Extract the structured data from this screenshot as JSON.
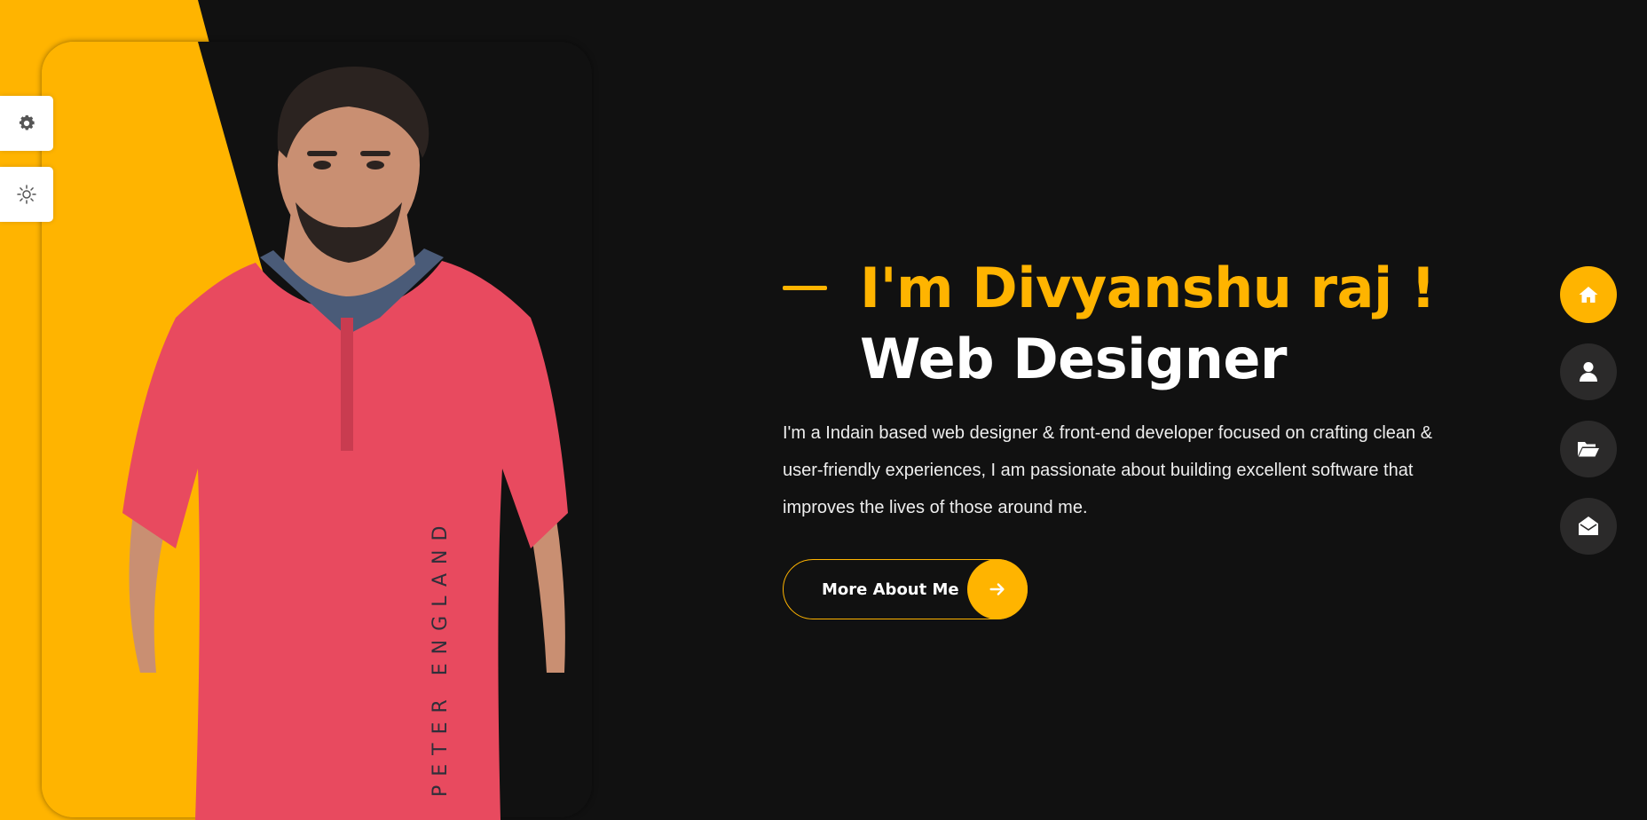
{
  "colors": {
    "accent": "#ffb400",
    "background": "#111111",
    "nav_inactive": "#2b2a2a",
    "shirt": "#e84a5f"
  },
  "settings_panel": {
    "buttons": [
      {
        "icon": "gear-icon"
      },
      {
        "icon": "sun-icon"
      }
    ]
  },
  "portrait": {
    "icon": "person-portrait",
    "shirt_text": "PETER ENGLAND"
  },
  "hero": {
    "name_line": "I'm Divyanshu raj !",
    "role_line": "Web Designer",
    "bio": "I'm a Indain based web designer & front-end developer focused on crafting clean & user-friendly experiences, I am passionate about building excellent software that improves the lives of those around me.",
    "cta_label": "More About Me",
    "cta_icon": "arrow-right-icon"
  },
  "side_nav": {
    "items": [
      {
        "icon": "home-icon",
        "active": true
      },
      {
        "icon": "user-icon",
        "active": false
      },
      {
        "icon": "folder-open-icon",
        "active": false
      },
      {
        "icon": "envelope-open-icon",
        "active": false
      }
    ]
  }
}
